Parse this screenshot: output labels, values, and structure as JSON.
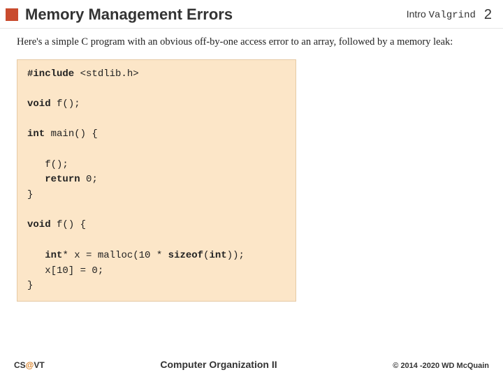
{
  "header": {
    "title": "Memory Management Errors",
    "breadcrumb_plain": "Intro ",
    "breadcrumb_mono": "Valgrind",
    "page_number": "2"
  },
  "intro": "Here's a simple C program with an obvious off-by-one access error to an array, followed by a memory leak:",
  "code": {
    "l01a": "#include",
    "l01b": " <stdlib.h>",
    "l02": "",
    "l03a": "void",
    "l03b": " f();",
    "l04": "",
    "l05a": "int",
    "l05b": " main() {",
    "l06": "",
    "l07": "   f();",
    "l08a": "   ",
    "l08b": "return",
    "l08c": " 0;",
    "l09": "}",
    "l10": "",
    "l11a": "void",
    "l11b": " f() {",
    "l12": "",
    "l13a": "   ",
    "l13b": "int",
    "l13c": "* x = malloc(10 * ",
    "l13d": "sizeof",
    "l13e": "(",
    "l13f": "int",
    "l13g": "));",
    "l14": "   x[10] = 0;",
    "l15": "}"
  },
  "footer": {
    "left_a": "CS",
    "left_b": "@",
    "left_c": "VT",
    "center": "Computer Organization II",
    "right": "© 2014 -2020 WD McQuain"
  }
}
